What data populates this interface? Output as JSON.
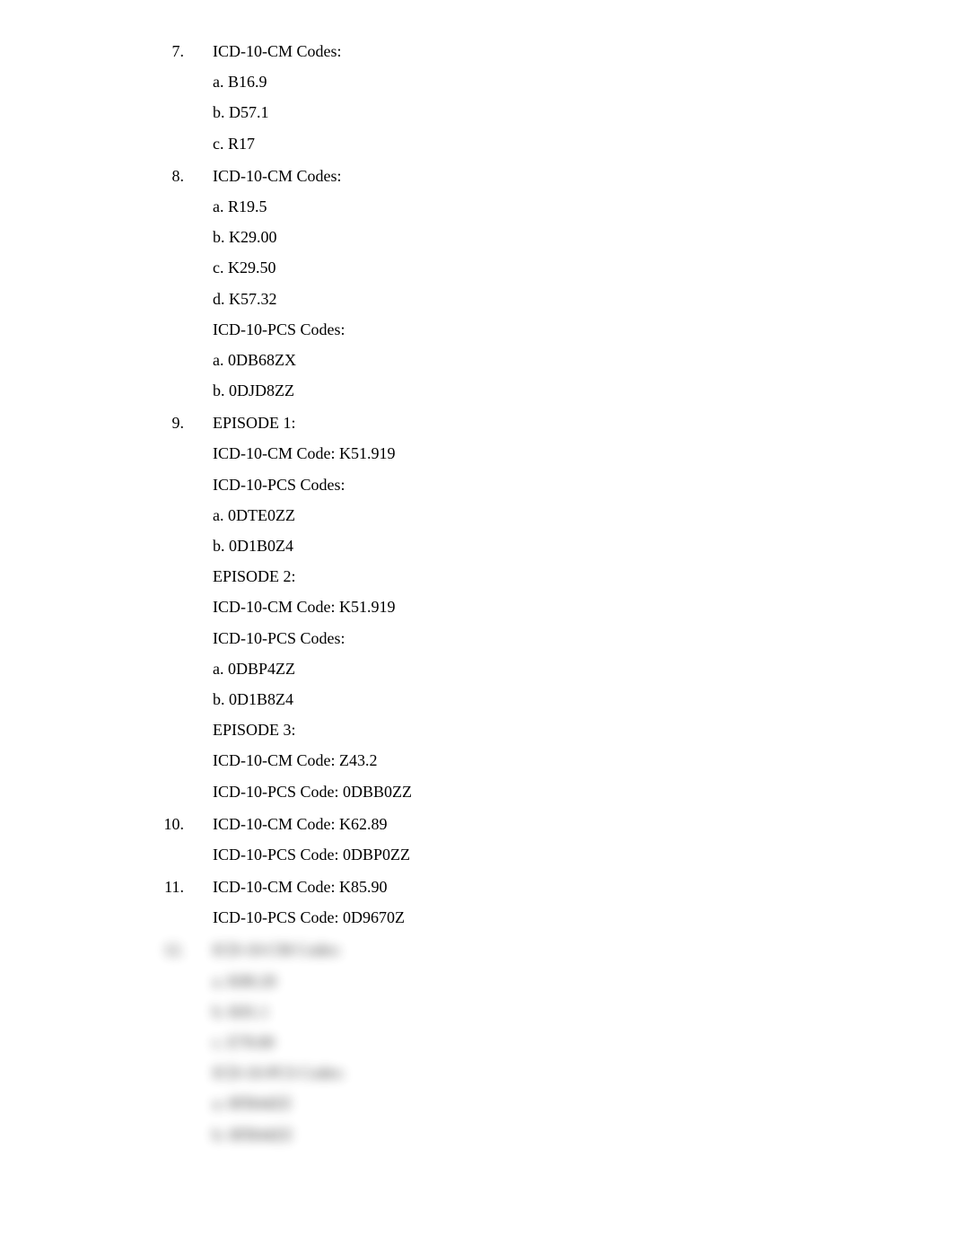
{
  "items": [
    {
      "number": "7.",
      "lines": [
        "ICD-10-CM Codes:",
        "a. B16.9",
        "b. D57.1",
        "c. R17"
      ]
    },
    {
      "number": "8.",
      "lines": [
        "ICD-10-CM Codes:",
        "a. R19.5",
        "b. K29.00",
        "c. K29.50",
        "d. K57.32",
        "ICD-10-PCS Codes:",
        "a. 0DB68ZX",
        "b. 0DJD8ZZ"
      ]
    },
    {
      "number": "9.",
      "lines": [
        "EPISODE 1:",
        "ICD-10-CM Code: K51.919",
        "ICD-10-PCS Codes:",
        "a. 0DTE0ZZ",
        "b. 0D1B0Z4",
        "EPISODE 2:",
        "ICD-10-CM Code: K51.919",
        "ICD-10-PCS Codes:",
        "a. 0DBP4ZZ",
        "b. 0D1B8Z4",
        "EPISODE 3:",
        "ICD-10-CM Code: Z43.2",
        "ICD-10-PCS Code: 0DBB0ZZ"
      ]
    },
    {
      "number": "10.",
      "lines": [
        "ICD-10-CM Code: K62.89",
        "ICD-10-PCS Code: 0DBP0ZZ"
      ]
    },
    {
      "number": "11.",
      "lines": [
        "ICD-10-CM Code: K85.90",
        "ICD-10-PCS Code: 0D9670Z"
      ]
    }
  ],
  "blurred_items": [
    {
      "number": "12.",
      "lines": [
        "ICD-10-CM Codes:",
        "a. K80.20",
        "b. K81.1",
        "c. E78.00",
        "ICD-10-PCS Codes:",
        "a. 0FB44ZZ",
        "b. 0FB44ZZ"
      ]
    }
  ]
}
